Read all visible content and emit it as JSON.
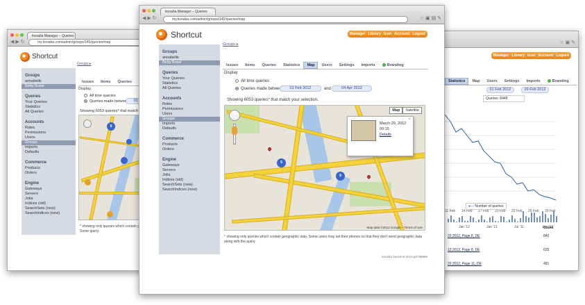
{
  "left_window": {
    "tab_title": "kooaba Manager – Queries",
    "url": "my.kooaba.com/admin/groups/145/queries/map",
    "logo_text": "Shortcut",
    "breadcrumb": "Groups ▸",
    "sidebar": [
      {
        "header": "Groups",
        "items": [
          "annabelle",
          "Betty Bossi"
        ],
        "active": 1
      },
      {
        "header": "Queries",
        "items": [
          "Your Queries",
          "Statistics",
          "All Queries"
        ]
      },
      {
        "header": "Accounts",
        "items": [
          "Roles",
          "Permissions",
          "Users",
          "Groups",
          "Imports",
          "Defaults"
        ],
        "active": 3
      },
      {
        "header": "Commerce",
        "items": [
          "Products",
          "Orders"
        ]
      },
      {
        "header": "Engine",
        "items": [
          "Gateways",
          "Servers",
          "Jobs",
          "Indices (old)",
          "SearchSets (new)",
          "SearchIndices (new)"
        ]
      }
    ],
    "tabs": [
      "Issues",
      "Items",
      "Queries",
      "Statisti"
    ],
    "display_label": "Display",
    "opt_all": "All time queries",
    "opt_between": "Queries made between",
    "date_from": "01 Feb",
    "showing": "Showing 6053 queries* that match your selection.",
    "footnote": "* showing only queries which contain geographic data. Some query."
  },
  "main_window": {
    "tab_title": "kooaba Manager – Queries",
    "url": "my.kooaba.com/admin/groups/145/queries/map",
    "logo_text": "Shortcut",
    "top_links": [
      "Manager",
      "Library",
      "Icon",
      "Account",
      "Logout"
    ],
    "breadcrumb": "Groups ▸",
    "sidebar": [
      {
        "header": "Groups",
        "items": [
          "annabelle",
          "Betty Bossi"
        ],
        "active": 1
      },
      {
        "header": "Queries",
        "items": [
          "Your Queries",
          "Statistics",
          "All Queries"
        ]
      },
      {
        "header": "Accounts",
        "items": [
          "Roles",
          "Permissions",
          "Users",
          "Groups",
          "Imports",
          "Defaults"
        ],
        "active": 3
      },
      {
        "header": "Commerce",
        "items": [
          "Products",
          "Orders"
        ]
      },
      {
        "header": "Engine",
        "items": [
          "Gateways",
          "Servers",
          "Jobs",
          "Indices (old)",
          "SearchSets (new)",
          "SearchIndices (new)"
        ]
      }
    ],
    "tabs": [
      "Issues",
      "Items",
      "Queries",
      "Statistics",
      "Map",
      "Users",
      "Settings",
      "Imports",
      "Branding"
    ],
    "active_tab": 4,
    "display_label": "Display",
    "opt_all": "All time queries",
    "opt_between": "Queries made between",
    "date_from": "01 Feb 2012",
    "and_label": "and",
    "date_to": "04 Apr 2012",
    "showing": "Showing 6053 queries* that match your selection.",
    "map_btn": "Map",
    "satellite_btn": "Satellite",
    "popup_date": "March 29, 2012",
    "popup_time": "09:15",
    "popup_link": "Details",
    "map_copyright": "Map data ©2012 Google – Terms of Use",
    "footnote": "* showing only queries which contain geographic data. Some users may set their phones so that they don't send geographic data along with the query.",
    "footer": "kooaba backend-4011-g9738986",
    "cluster_labels": [
      "9",
      "8"
    ]
  },
  "right_window": {
    "top_links": [
      "Manager",
      "Library",
      "Icon",
      "Account",
      "Logout"
    ],
    "tabs": [
      "Statistics",
      "Map",
      "Users",
      "Settings",
      "Imports",
      "Branding"
    ],
    "date_from": "01 Feb 2012",
    "date_to": "29 Feb 2012",
    "queries_label": "Queries: 8448",
    "x_ticks": [
      "11 Feb",
      "14 Feb",
      "17 Feb",
      "20 Feb",
      "23 Feb",
      "26 Feb",
      "29 Feb"
    ],
    "range_ticks": [
      "Jan '12",
      "Jan '11",
      "Jul '11",
      "Jan '12"
    ],
    "legend": "Number of queries",
    "count_header": "Count",
    "rows": [
      {
        "label": "22.2012, Page 8, DE",
        "count": "840"
      },
      {
        "label": "12.2012, Page 8, DE",
        "count": "635"
      },
      {
        "label": "22.2012, Page 11, DE",
        "count": "481"
      }
    ]
  },
  "colors": {
    "accent": "#e6821c",
    "sidebar": "#d6dbe3",
    "chart_line": "#2f5fa6"
  }
}
